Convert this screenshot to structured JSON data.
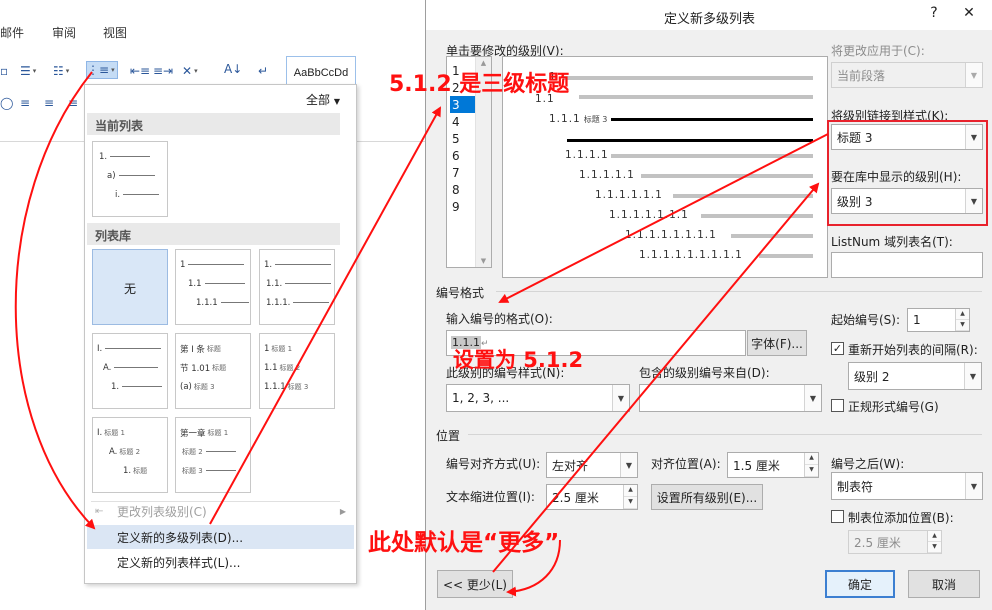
{
  "ribbon": {
    "tabs": [
      "邮件",
      "审阅",
      "视图"
    ],
    "style_preview": "AaBbCcDd"
  },
  "menu": {
    "filter_label": "全部",
    "current_list_header": "当前列表",
    "current_list_lines": [
      "1.",
      "a)",
      "i."
    ],
    "library_header": "列表库",
    "none_label": "无",
    "lib2": [
      "1",
      "1.1",
      "1.1.1"
    ],
    "lib3": [
      "1.",
      "1.1.",
      "1.1.1."
    ],
    "lib4": [
      "I.",
      "A.",
      "1."
    ],
    "lib5": [
      {
        "num": "第 I 条",
        "sub": "标题"
      },
      {
        "num": "节 1.01",
        "sub": "标题"
      },
      {
        "num": "(a)",
        "sub": "标题 3"
      }
    ],
    "lib6": [
      {
        "num": "1",
        "sub": "标题 1"
      },
      {
        "num": "1.1",
        "sub": "标题 2"
      },
      {
        "num": "1.1.1",
        "sub": "标题 3"
      }
    ],
    "lib7": [
      {
        "num": "I.",
        "sub": "标题 1"
      },
      {
        "num": "A.",
        "sub": "标题 2"
      },
      {
        "num": "1.",
        "sub": "标题"
      }
    ],
    "lib8": [
      {
        "num": "第一章",
        "sub": "标题 1"
      },
      {
        "num": "",
        "sub": "标题 2"
      },
      {
        "num": "",
        "sub": "标题 3"
      }
    ],
    "change_level": "更改列表级别(C)",
    "define_multilevel": "定义新的多级列表(D)...",
    "define_style": "定义新的列表样式(L)..."
  },
  "dialog": {
    "title": "定义新多级列表",
    "help": "?",
    "close": "✕",
    "click_level_label": "单击要修改的级别(V):",
    "levels": [
      "1",
      "2",
      "3",
      "4",
      "5",
      "6",
      "7",
      "8",
      "9"
    ],
    "selected_level": "3",
    "preview_rows": [
      {
        "num": "1",
        "sub": ""
      },
      {
        "num": "1.1",
        "sub": ""
      },
      {
        "num": "1.1.1",
        "sub": "标题 3"
      },
      {
        "num": "",
        "sub": ""
      },
      {
        "num": "1.1.1.1",
        "sub": ""
      },
      {
        "num": "1.1.1.1.1",
        "sub": ""
      },
      {
        "num": "1.1.1.1.1.1",
        "sub": ""
      },
      {
        "num": "1.1.1.1.1.1.1",
        "sub": ""
      },
      {
        "num": "1.1.1.1.1.1.1.1",
        "sub": ""
      },
      {
        "num": "1.1.1.1.1.1.1.1.1",
        "sub": ""
      }
    ],
    "apply_to_label": "将更改应用于(C):",
    "apply_to_value": "当前段落",
    "link_style_label": "将级别链接到样式(K):",
    "link_style_value": "标题 3",
    "gallery_level_label": "要在库中显示的级别(H):",
    "gallery_level_value": "级别 3",
    "listnum_label": "ListNum 域列表名(T):",
    "listnum_value": "",
    "number_format_group": "编号格式",
    "enter_format_label": "输入编号的格式(O):",
    "enter_format_value": "1.1.1",
    "font_button": "字体(F)...",
    "num_style_label": "此级别的编号样式(N):",
    "num_style_value": "1, 2, 3, ...",
    "include_level_label": "包含的级别编号来自(D):",
    "include_level_value": "",
    "start_at_label": "起始编号(S):",
    "start_at_value": "1",
    "restart_label": "重新开始列表的间隔(R):",
    "restart_value": "级别 2",
    "legal_label": "正规形式编号(G)",
    "position_group": "位置",
    "alignment_label": "编号对齐方式(U):",
    "alignment_value": "左对齐",
    "aligned_at_label": "对齐位置(A):",
    "aligned_at_value": "1.5 厘米",
    "indent_label": "文本缩进位置(I):",
    "indent_value": "2.5 厘米",
    "set_all_button": "设置所有级别(E)...",
    "follow_label": "编号之后(W):",
    "follow_value": "制表符",
    "tab_add_label": "制表位添加位置(B):",
    "tab_add_value": "2.5 厘米",
    "less_button": "<< 更少(L)",
    "ok_button": "确定",
    "cancel_button": "取消"
  },
  "annotations": {
    "heading_note": "5.1.2 是三级标题",
    "format_note": "设置为 5.1.2",
    "default_note": "此处默认是“更多”",
    "color": "#ff1010"
  }
}
